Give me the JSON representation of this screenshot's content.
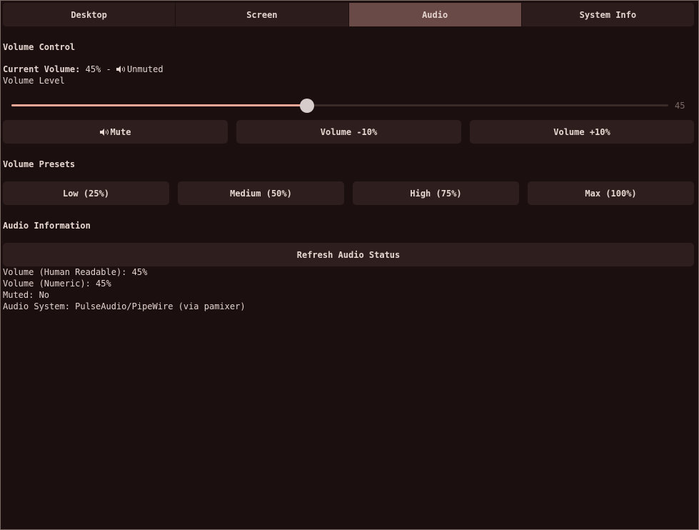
{
  "tabs": [
    {
      "label": "Desktop",
      "active": false
    },
    {
      "label": "Screen",
      "active": false
    },
    {
      "label": "Audio",
      "active": true
    },
    {
      "label": "System Info",
      "active": false
    }
  ],
  "volume_control": {
    "heading": "Volume Control",
    "current_label": "Current Volume:",
    "current_value": "45% -",
    "state_icon": "speaker-icon",
    "state": "Unmuted",
    "slider_label": "Volume Level",
    "slider": {
      "value": 45,
      "min": 0,
      "max": 100
    },
    "slider_value_text": "45",
    "buttons": {
      "mute": "Mute",
      "down": "Volume -10%",
      "up": "Volume +10%"
    }
  },
  "presets": {
    "heading": "Volume Presets",
    "items": [
      "Low (25%)",
      "Medium (50%)",
      "High (75%)",
      "Max (100%)"
    ]
  },
  "audio_info": {
    "heading": "Audio Information",
    "refresh_label": "Refresh Audio Status",
    "lines": [
      "Volume (Human Readable): 45%",
      "Volume (Numeric): 45%",
      "Muted: No",
      "Audio System: PulseAudio/PipeWire (via pamixer)"
    ]
  },
  "colors": {
    "background": "#1c0f0f",
    "accent": "#f0a798",
    "active_tab": "#6a4a46",
    "button": "#2e1e1e"
  }
}
